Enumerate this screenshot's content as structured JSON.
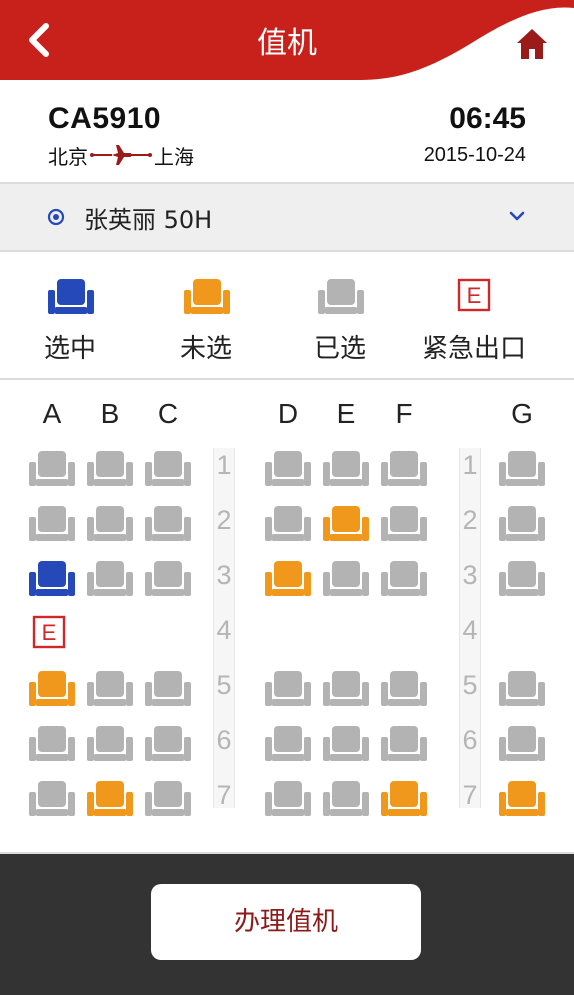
{
  "colors": {
    "header_red": "#c8201a",
    "home_icon": "#9b1b1b",
    "selected": "#2549b8",
    "available": "#f0981c",
    "taken": "#b3b3b3",
    "exit": "#d02828",
    "footer": "#333333",
    "button_text": "#8b1a1a"
  },
  "header": {
    "title": "值机",
    "back_icon": "chevron-left-icon",
    "home_icon": "home-icon"
  },
  "flight": {
    "number": "CA5910",
    "origin": "北京",
    "destination": "上海",
    "time": "06:45",
    "date": "2015-10-24"
  },
  "passenger": {
    "label": "张英丽 50H",
    "icon": "radio-icon",
    "chevron_icon": "chevron-down-icon"
  },
  "legend": [
    {
      "status": "selected",
      "label": "选中"
    },
    {
      "status": "available",
      "label": "未选"
    },
    {
      "status": "taken",
      "label": "已选"
    },
    {
      "status": "exit",
      "label": "紧急出口",
      "icon_text": "E"
    }
  ],
  "seatmap": {
    "columns": [
      "A",
      "B",
      "C",
      "D",
      "E",
      "F",
      "G"
    ],
    "rows": [
      "1",
      "2",
      "3",
      "4",
      "5",
      "6",
      "7"
    ],
    "exit_marker": "E",
    "seats": {
      "1": [
        "taken",
        "taken",
        "taken",
        "taken",
        "taken",
        "taken",
        "taken"
      ],
      "2": [
        "taken",
        "taken",
        "taken",
        "taken",
        "available",
        "taken",
        "taken"
      ],
      "3": [
        "selected",
        "taken",
        "taken",
        "available",
        "taken",
        "taken",
        "taken"
      ],
      "4": [
        "exit",
        "none",
        "none",
        "none",
        "none",
        "none",
        "none"
      ],
      "5": [
        "available",
        "taken",
        "taken",
        "taken",
        "taken",
        "taken",
        "taken"
      ],
      "6": [
        "taken",
        "taken",
        "taken",
        "taken",
        "taken",
        "taken",
        "taken"
      ],
      "7": [
        "taken",
        "available",
        "taken",
        "taken",
        "taken",
        "available",
        "available"
      ]
    }
  },
  "footer": {
    "checkin_label": "办理值机"
  }
}
